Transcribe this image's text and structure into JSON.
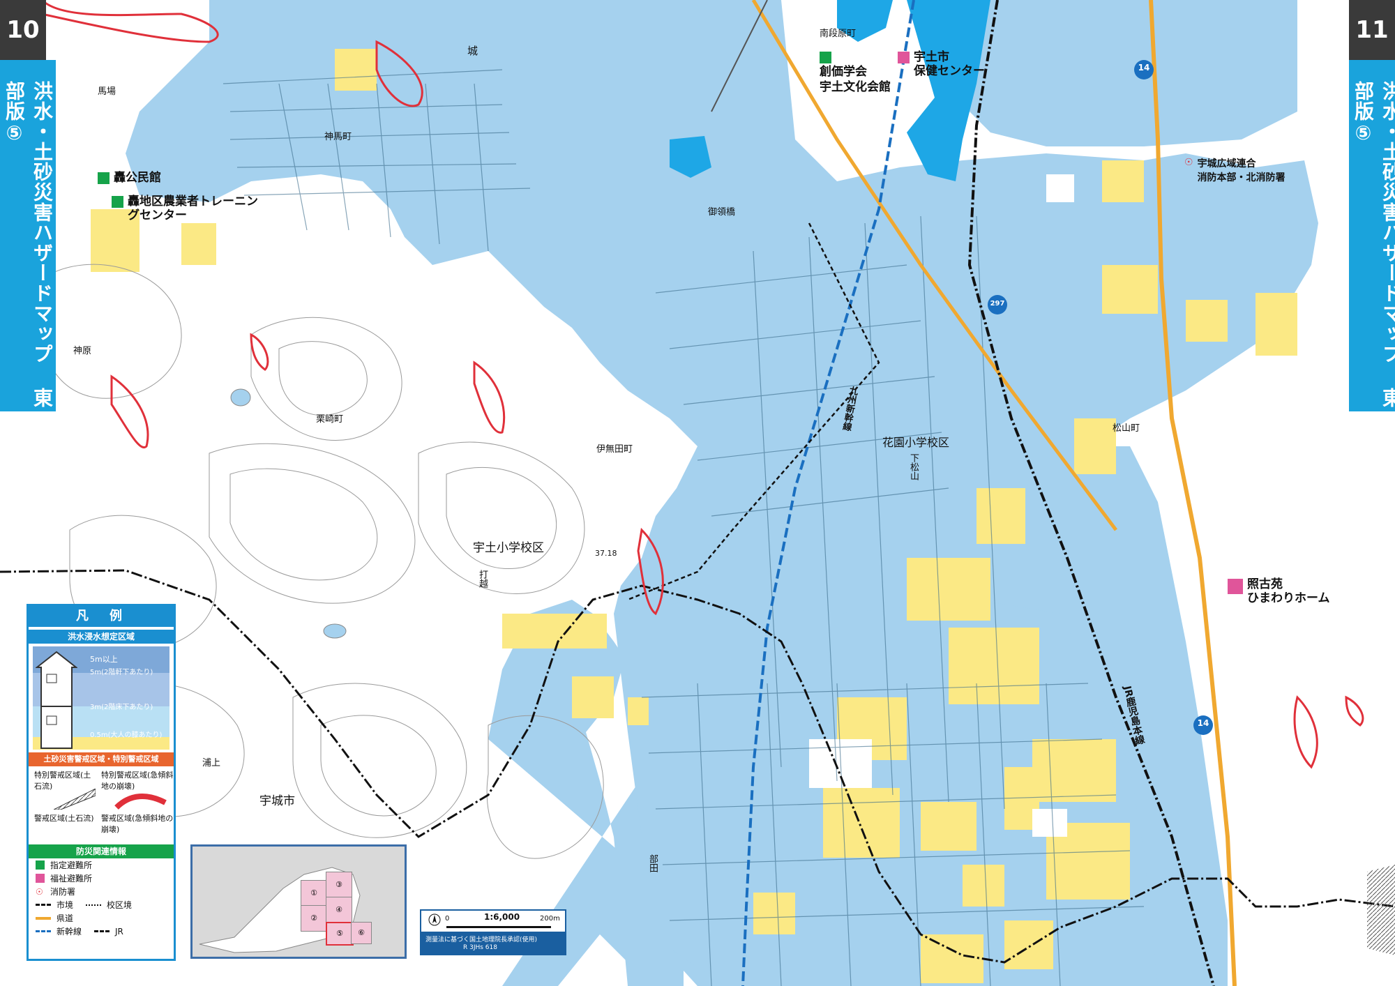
{
  "page": {
    "left_page_number": "10",
    "right_page_number": "11",
    "side_title": "洪水・土砂災害ハザードマップ 東部版⑤"
  },
  "colors": {
    "flood_blue": "#a5d1ee",
    "deep_blue": "#1ea7e6",
    "shallow_yellow": "#fbe985",
    "tab_blue": "#1aa3dc",
    "tab_gray": "#3a3a3a",
    "shelter_green": "#16a34a",
    "welfare_pink": "#e0559a",
    "hazard_red": "#e0303a"
  },
  "places": {
    "minamidanbaramachi": "南段原町",
    "shiro": "城",
    "baba": "馬場",
    "kamitoramachi": "神馬町",
    "goryobashi": "御領橋",
    "kanbara": "神原",
    "kurisakimachi": "栗崎町",
    "ibutamachi": "伊無田町",
    "hanazono_school_district": "花園小学校区",
    "shimomatsuyama": "下松山",
    "matsuyamamachi": "松山町",
    "uto_school_district": "宇土小学校区",
    "elevation": "37.18",
    "uki_city": "宇城市",
    "urakami": "浦上",
    "uchikoshi": "打越",
    "heta": "部田",
    "shinkansen": "九州新幹線",
    "jr_line": "JR鹿児島本線",
    "route14_a": "14",
    "route14_b": "14",
    "route297": "297"
  },
  "pois": {
    "todoroki_hall": "轟公民館",
    "todoroki_farm": "轟地区農業者トレーニングセンター",
    "soka_1": "創価学会",
    "soka_2": "宇土文化会館",
    "health_1": "宇土市",
    "health_2": "保健センター",
    "fire_1": "宇城広域連合",
    "fire_2": "消防本部・北消防署",
    "terukoen_1": "照古苑",
    "terukoen_2": "ひまわりホーム"
  },
  "legend": {
    "title": "凡　例",
    "flood_section": "洪水浸水想定区域",
    "depth_5m_over": "5m以上",
    "depth_5m": "5m(2階軒下あたり)",
    "depth_3m": "3m(2階床下あたり)",
    "depth_05m": "0.5m(大人の膝あたり)",
    "landslide_section": "土砂災害警戒区域・特別警戒区域",
    "special_debris": "特別警戒区域(土石流)",
    "special_slope": "特別警戒区域(急傾斜地の崩壊)",
    "warn_debris": "警戒区域(土石流)",
    "warn_slope": "警戒区域(急傾斜地の崩壊)",
    "info_section": "防災関連情報",
    "designated_shelter": "指定避難所",
    "welfare_shelter": "福祉避難所",
    "fire_station": "消防署",
    "city_border": "市境",
    "school_border": "校区境",
    "pref_road": "県道",
    "shinkansen": "新幹線",
    "jr": "JR"
  },
  "inset": {
    "cells": [
      "①",
      "②",
      "③",
      "④",
      "⑤",
      "⑥"
    ]
  },
  "scale": {
    "zero": "0",
    "ratio": "1:6,000",
    "distance": "200m",
    "note": "測量法に基づく国土地理院長承認(使用)",
    "permit": "R 3JHs 618"
  }
}
